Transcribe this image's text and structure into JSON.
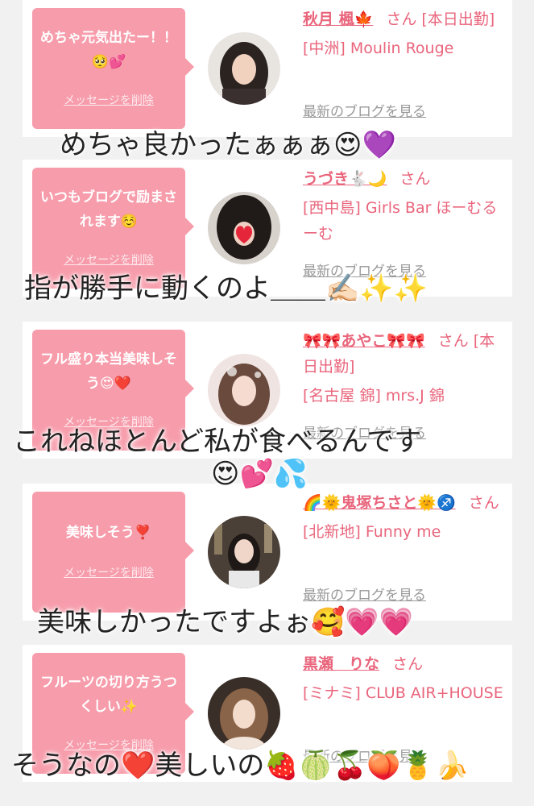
{
  "cards": [
    {
      "bubble_text": "めちゃ元気出たー！！🥺💕",
      "delete_label": "メッセージを削除",
      "name": "秋月 楓🍁",
      "san": "さん",
      "status": "[本日出勤]",
      "area": "[中洲]",
      "shop": "Moulin Rouge",
      "blog_link": "最新のブログを見る"
    },
    {
      "bubble_text": "いつもブログで励まされます☺️",
      "delete_label": "メッセージを削除",
      "name": "うづき🐇🌙",
      "san": "さん",
      "status": "",
      "area": "[西中島]",
      "shop": "Girls Bar ほーむるーむ",
      "blog_link": "最新のブログを見る"
    },
    {
      "bubble_text": "フル盛り本当美味しそう😍❤️",
      "delete_label": "メッセージを削除",
      "name": "🎀🎀あやこ🎀🎀",
      "san": "さん",
      "status": "[本日出勤]",
      "area": "[名古屋 錦]",
      "shop": "mrs.J 錦",
      "blog_link": "最新のブログを見る"
    },
    {
      "bubble_text": "美味しそう❣️",
      "delete_label": "メッセージを削除",
      "name": "🌈🌞鬼塚ちさと🌞♐️",
      "san": "さん",
      "status": "",
      "area": "[北新地]",
      "shop": "Funny me",
      "blog_link": "最新のブログを見る"
    },
    {
      "bubble_text": "フルーツの切り方うつくしい✨",
      "delete_label": "メッセージを削除",
      "name": "黒瀬　りな",
      "san": "さん",
      "status": "",
      "area": "[ミナミ]",
      "shop": "CLUB AIR+HOUSE",
      "blog_link": "最新のブログを見る"
    }
  ],
  "captions": [
    "めちゃ良かったぁぁぁ😍💜",
    "指が勝手に動くのよ＿＿✍🏻✨✨",
    "これねほとんど私が食べるんです",
    "😍💕💦",
    "美味しかったですよぉ🥰💗💗",
    "そうなの❤️美しいの🍓🍈🍒🍑🍍🍌"
  ],
  "colors": {
    "bubble": "#f79cab",
    "accent": "#e9657c",
    "link": "#999999"
  }
}
